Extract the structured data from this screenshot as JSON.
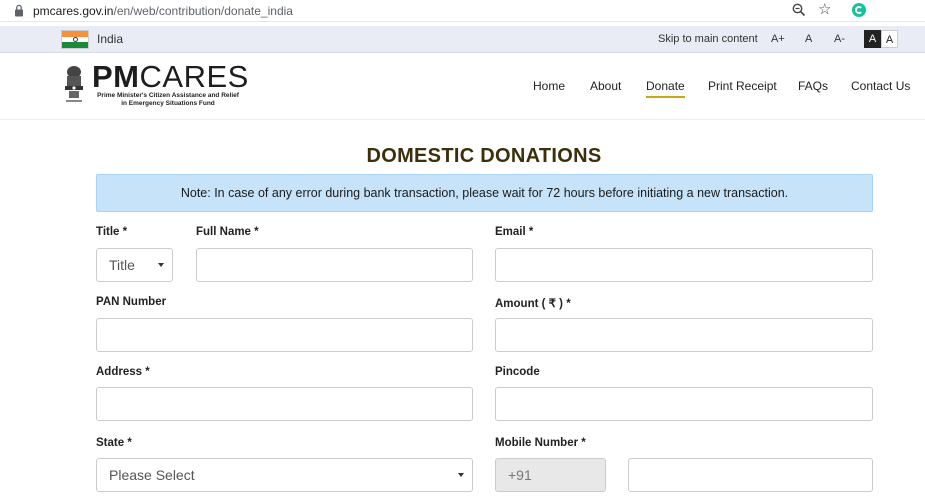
{
  "browser": {
    "url_domain": "pmcares.gov.in",
    "url_path": "/en/web/contribution/donate_india"
  },
  "utility": {
    "country": "India",
    "skip_link": "Skip to main content",
    "font_increase": "A+",
    "font_normal": "A",
    "font_decrease": "A-",
    "contrast_dark": "A",
    "contrast_light": "A"
  },
  "header": {
    "logo_pm": "PM",
    "logo_cares": "CARES",
    "logo_sub_line1": "Prime Minister's Citizen Assistance and Relief",
    "logo_sub_line2": "in Emergency Situations Fund",
    "nav": {
      "home": "Home",
      "about": "About",
      "donate": "Donate",
      "print_receipt": "Print Receipt",
      "faqs": "FAQs",
      "contact": "Contact Us"
    }
  },
  "main": {
    "title": "DOMESTIC DONATIONS",
    "note": "Note: In case of any error during bank transaction, please wait for 72 hours before initiating a new transaction.",
    "form": {
      "title_label": "Title *",
      "title_select": "Title",
      "fullname_label": "Full Name *",
      "email_label": "Email *",
      "pan_label": "PAN Number",
      "amount_label": "Amount ( ₹ ) *",
      "address_label": "Address *",
      "pincode_label": "Pincode",
      "state_label": "State *",
      "state_select": "Please Select",
      "mobile_label": "Mobile Number *",
      "mobile_prefix": "+91"
    }
  },
  "colors": {
    "utility_bar": "#e9ebf5",
    "note_bg": "#c6e3fa",
    "title_color": "#3b2f0c",
    "nav_active_underline": "#c8a81b"
  }
}
